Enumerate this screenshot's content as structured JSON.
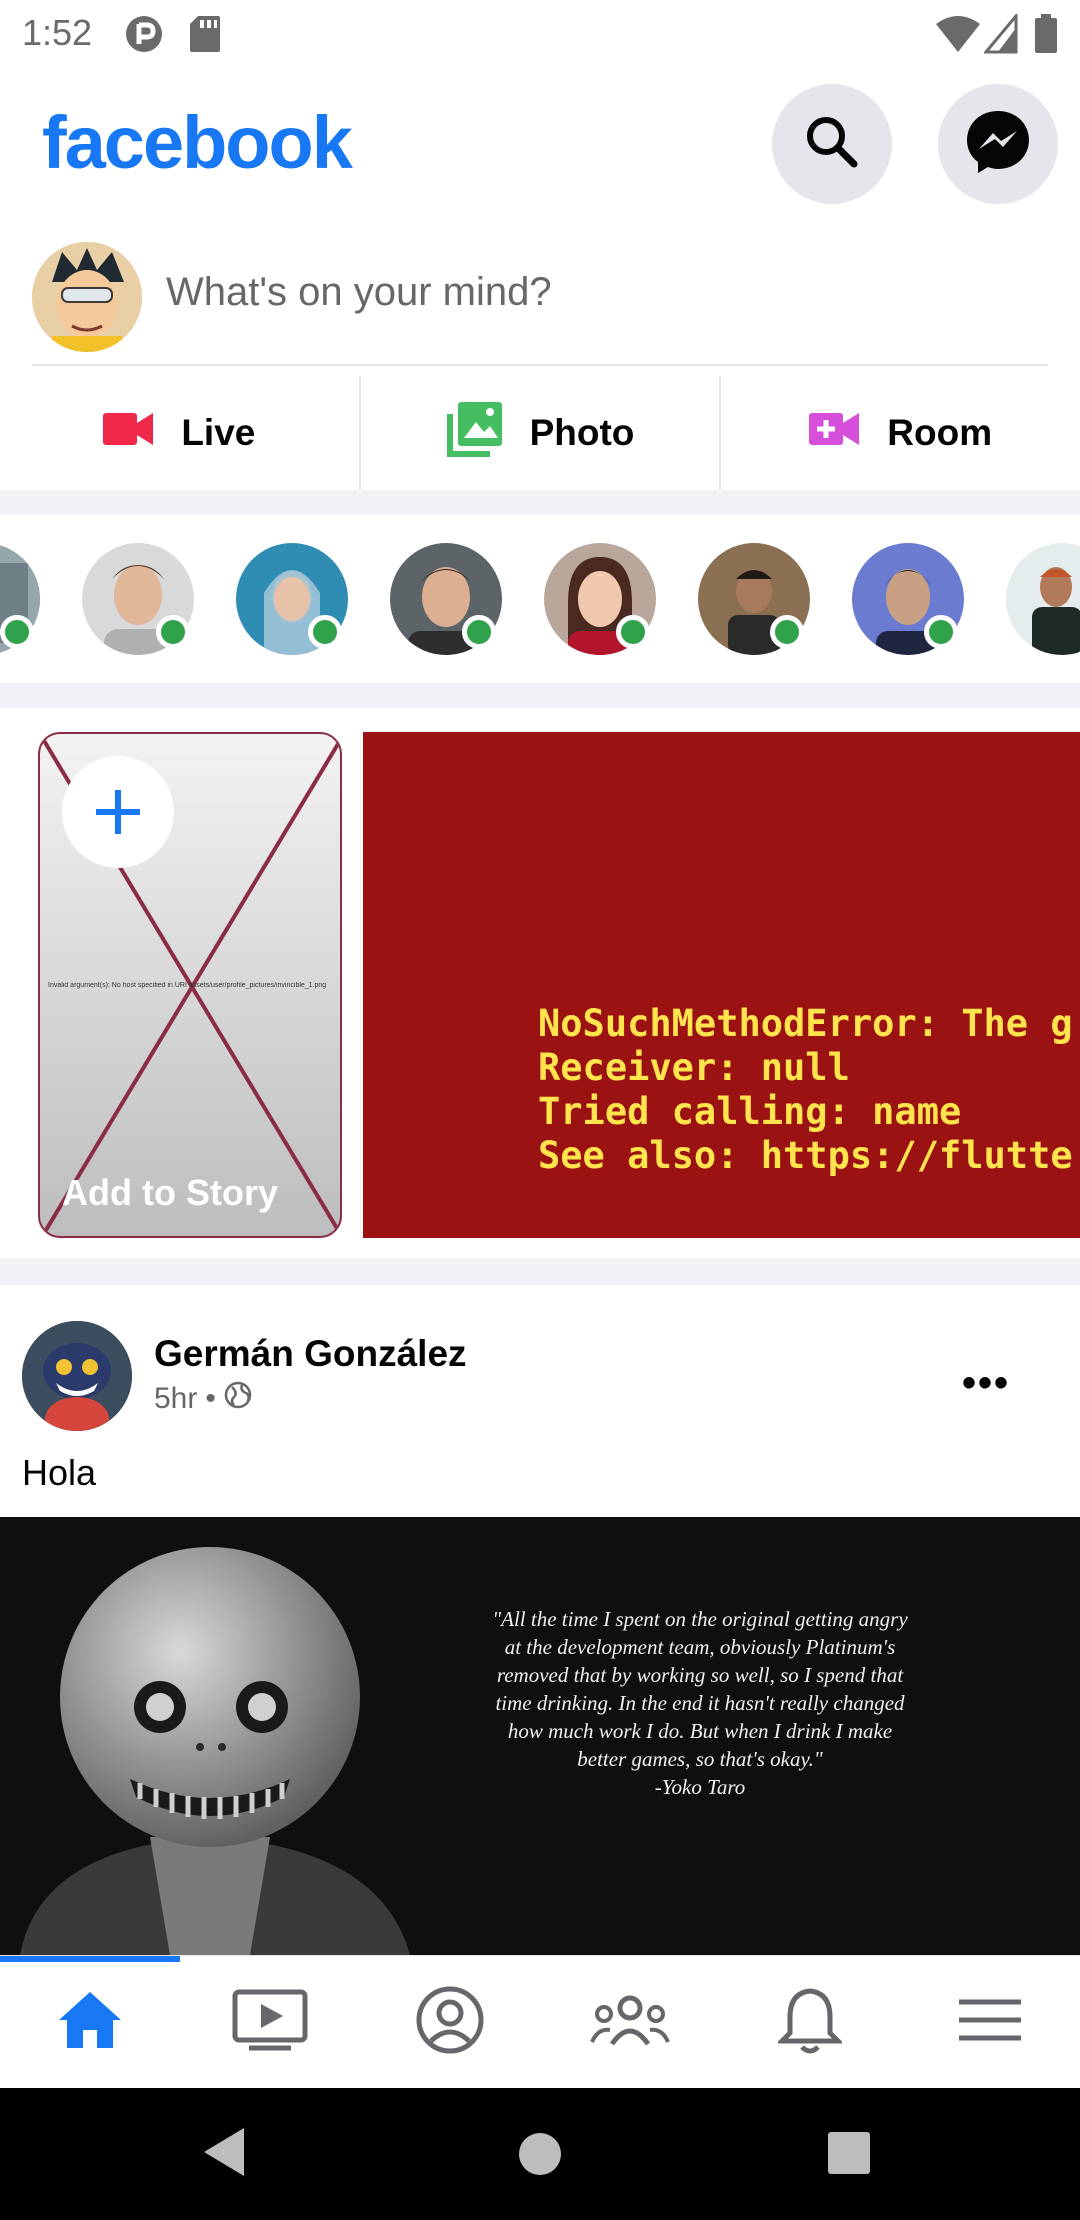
{
  "status_bar": {
    "time": "1:52"
  },
  "header": {
    "logo": "facebook"
  },
  "composer": {
    "placeholder": "What's on your mind?"
  },
  "actions": [
    {
      "label": "Live"
    },
    {
      "label": "Photo"
    },
    {
      "label": "Room"
    }
  ],
  "stories": {
    "add_label": "Add to Story",
    "broken_image_message": "Invalid argument(s): No host specified in URI assets/user/profile_pictures/invincible_1.png",
    "error_lines": [
      "NoSuchMethodError: The g",
      "Receiver: null",
      "Tried calling: name",
      "See also: https://flutte"
    ]
  },
  "post": {
    "author": "Germán González",
    "time": "5hr",
    "separator": "•",
    "more": "•••",
    "text": "Hola",
    "quote_lines": [
      "\"All the time I spent on the original getting angry",
      "at the development team, obviously Platinum's",
      "removed that by working so well, so I spend that",
      "time drinking. In the end it hasn't really changed",
      "how much work I do. But when I drink I make",
      "better games, so that's okay.\"",
      "-Yoko Taro"
    ]
  },
  "bottom_nav": [
    {
      "icon": "home-icon",
      "active": true
    },
    {
      "icon": "watch-icon",
      "active": false
    },
    {
      "icon": "profile-icon",
      "active": false
    },
    {
      "icon": "groups-icon",
      "active": false
    },
    {
      "icon": "bell-icon",
      "active": false
    },
    {
      "icon": "menu-icon",
      "active": false
    }
  ],
  "colors": {
    "brand": "#1877f2",
    "online": "#31a24c",
    "live": "#f02849",
    "photo": "#45bd62",
    "room": "#d64fdb",
    "error_bg": "#9a1212",
    "error_text": "#ffe44d"
  }
}
